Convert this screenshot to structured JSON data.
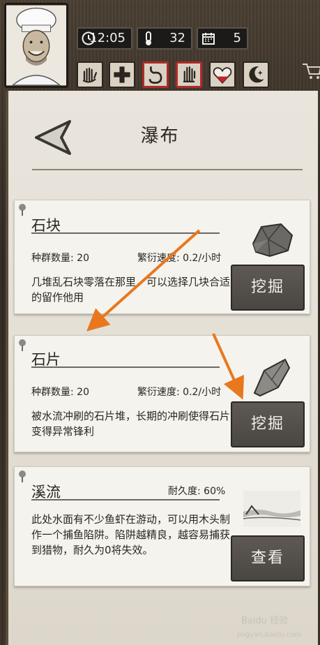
{
  "hud": {
    "time": "12:05",
    "temperature": "32",
    "day": "5"
  },
  "page": {
    "title": "瀑布"
  },
  "resources": [
    {
      "name": "石块",
      "population_label": "种群数量: 20",
      "growth_label": "繁衍速度: 0.2/小时",
      "description": "几堆乱石块零落在那里，可以选择几块合适的留作他用",
      "action": "挖掘"
    },
    {
      "name": "石片",
      "population_label": "种群数量: 20",
      "growth_label": "繁衍速度: 0.2/小时",
      "description": "被水流冲刷的石片堆，长期的冲刷使得石片变得异常锋利",
      "action": "挖掘"
    },
    {
      "name": "溪流",
      "durability_label": "耐久度: 60%",
      "description": "此处水面有不少鱼虾在游动，可以用木头制作一个捕鱼陷阱。陷阱越精良，越容易捕获到猎物，耐久为0将失效。",
      "action": "查看"
    }
  ],
  "watermark": {
    "text": "Baidu 经验",
    "sub": "jingyan.baidu.com"
  },
  "colors": {
    "annotation_arrow": "#e8781e",
    "active_skill_border": "#b02a2a",
    "button_bg": "#4a4642"
  },
  "icons": {
    "clock": "clock-icon",
    "thermometer": "thermometer-icon",
    "calendar": "calendar-icon",
    "skills": [
      "hand-icon",
      "health-cross-icon",
      "stomach-icon",
      "hand-raised-icon",
      "heart-icon",
      "moon-icon"
    ],
    "cart": "cart-icon",
    "back": "back-arrow-icon"
  }
}
